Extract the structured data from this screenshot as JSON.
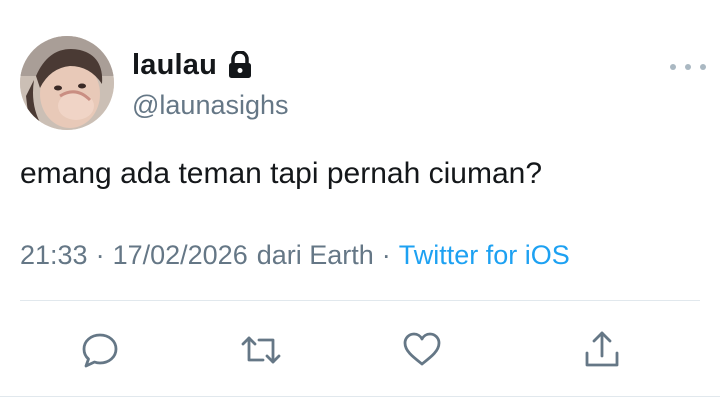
{
  "user": {
    "display_name": "laulau",
    "handle": "@launasighs",
    "protected_icon": "lock-icon",
    "avatar": "profile-photo"
  },
  "tweet": {
    "text": "emang ada teman tapi pernah ciuman?",
    "time": "21:33",
    "date": "17/02/2026",
    "location": "dari Earth",
    "separator": "·",
    "source": "Twitter for iOS"
  },
  "header": {
    "more_icon": "more-horizontal-icon"
  },
  "actions": [
    {
      "name": "reply",
      "icon": "speech-bubble-icon"
    },
    {
      "name": "retweet",
      "icon": "retweet-arrows-icon"
    },
    {
      "name": "like",
      "icon": "heart-icon"
    },
    {
      "name": "share",
      "icon": "share-upload-icon"
    }
  ],
  "colors": {
    "text": "#14171a",
    "secondary": "#657786",
    "link": "#1da1f2",
    "icon": "#657786",
    "divider": "#e1e8ed"
  }
}
